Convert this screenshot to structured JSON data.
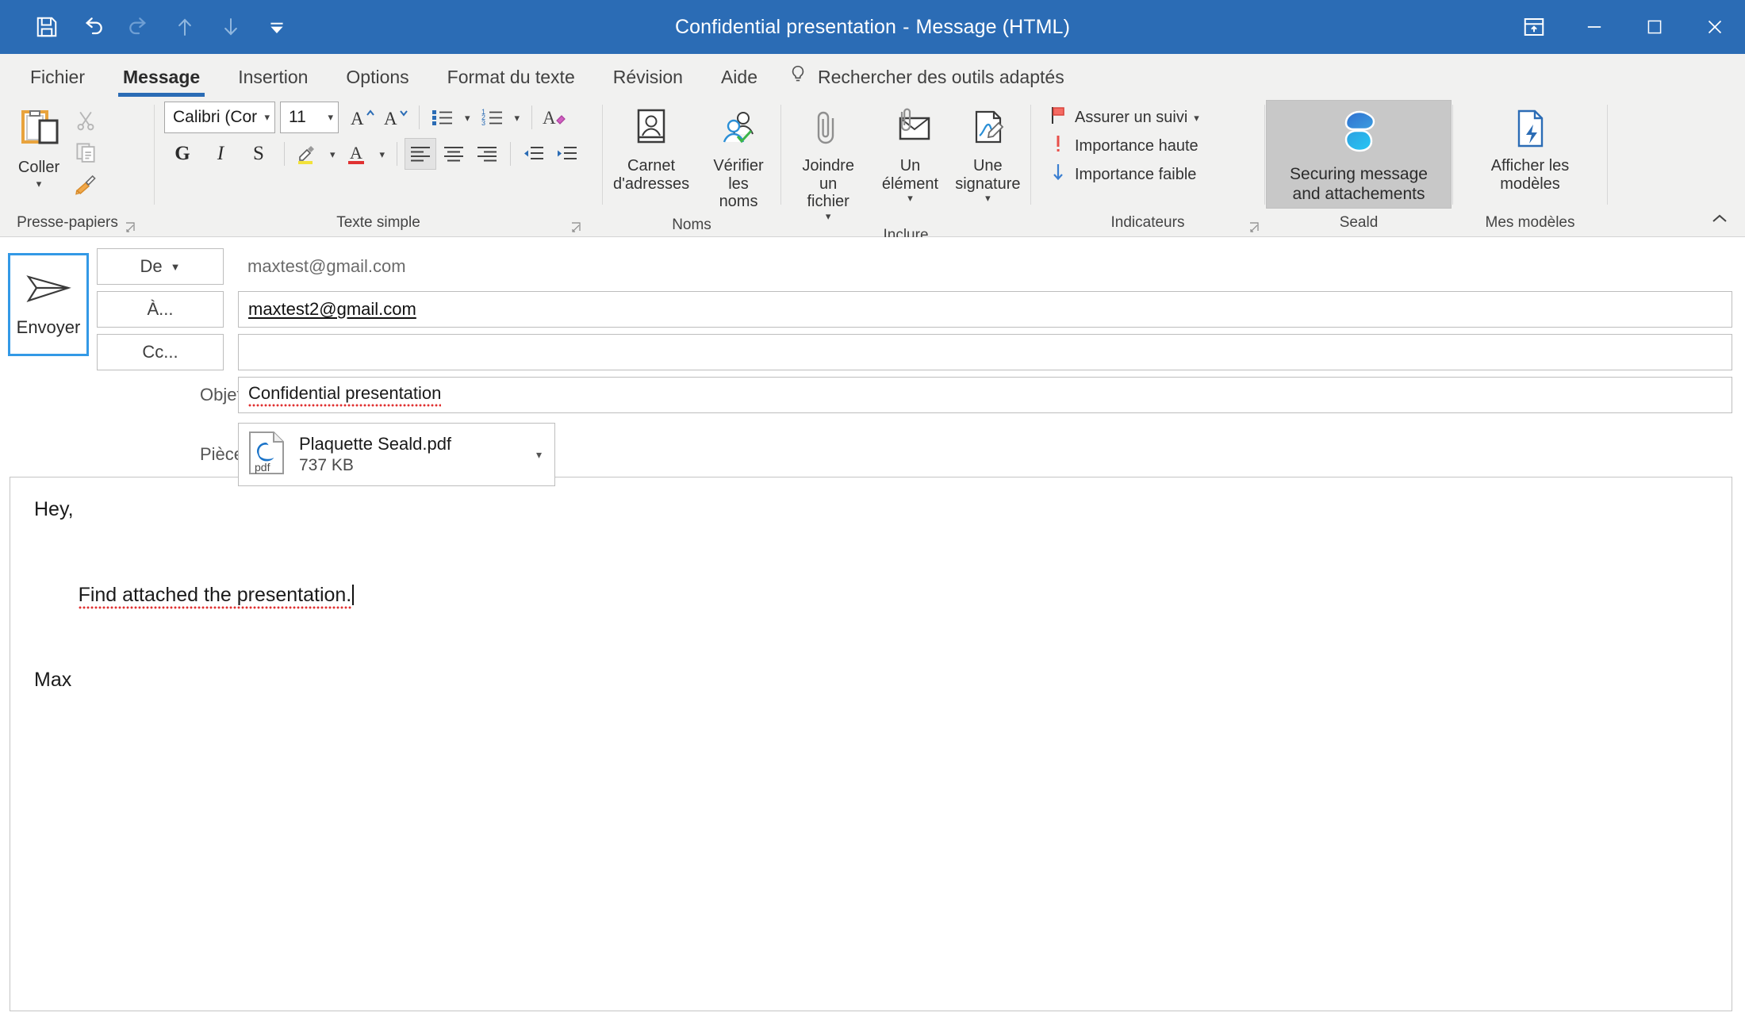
{
  "window": {
    "title": "Confidential presentation",
    "title_separator": "-",
    "title_suffix": "Message (HTML)",
    "accent_color": "#2b6cb5",
    "quick_access": [
      {
        "name": "save-icon",
        "label": "Enregistrer"
      },
      {
        "name": "undo-icon",
        "label": "Annuler"
      },
      {
        "name": "redo-icon",
        "label": "Rétablir"
      },
      {
        "name": "previous-item-icon",
        "label": "Élément précédent"
      },
      {
        "name": "next-item-icon",
        "label": "Élément suivant"
      },
      {
        "name": "customize-quick-access-icon",
        "label": "Personnaliser la barre d'outils Accès rapide"
      }
    ],
    "controls": {
      "ribbon_display": "Options d'affichage du ruban",
      "minimize": "Réduire",
      "maximize": "Agrandir",
      "close": "Fermer"
    }
  },
  "tabs": [
    {
      "label": "Fichier",
      "active": false
    },
    {
      "label": "Message",
      "active": true
    },
    {
      "label": "Insertion",
      "active": false
    },
    {
      "label": "Options",
      "active": false
    },
    {
      "label": "Format du texte",
      "active": false
    },
    {
      "label": "Révision",
      "active": false
    },
    {
      "label": "Aide",
      "active": false
    }
  ],
  "tell_me": {
    "icon": "lightbulb-icon",
    "text": "Rechercher des outils adaptés"
  },
  "ribbon": {
    "collapse_label": "Réduire le ruban",
    "groups": [
      {
        "name": "clipboard",
        "label": "Presse-papiers",
        "has_launcher": true,
        "paste": {
          "label": "Coller",
          "has_dropdown": true
        },
        "items": [
          {
            "name": "cut-icon",
            "label": "Couper",
            "disabled": true
          },
          {
            "name": "copy-icon",
            "label": "Copier",
            "disabled": true
          },
          {
            "name": "format-painter-icon",
            "label": "Reproduire la mise en forme"
          }
        ]
      },
      {
        "name": "basic-text",
        "label": "Texte simple",
        "has_launcher": true,
        "font_name": "Calibri (Cor",
        "font_size": "11",
        "buttons": [
          {
            "name": "grow-font-button",
            "label": "A"
          },
          {
            "name": "shrink-font-button",
            "label": "A"
          },
          {
            "name": "bullets-button",
            "label": "Puces"
          },
          {
            "name": "numbering-button",
            "label": "Numérotation"
          },
          {
            "name": "clear-formatting-button",
            "label": "Effacer la mise en forme"
          },
          {
            "name": "bold-button",
            "label": "G"
          },
          {
            "name": "italic-button",
            "label": "I"
          },
          {
            "name": "underline-button",
            "label": "S"
          },
          {
            "name": "text-highlight-button",
            "label": "Couleur de surlignage du texte"
          },
          {
            "name": "font-color-button",
            "label": "Couleur de police"
          },
          {
            "name": "align-left-button",
            "label": "Aligner à gauche"
          },
          {
            "name": "align-center-button",
            "label": "Centrer"
          },
          {
            "name": "align-right-button",
            "label": "Aligner à droite"
          },
          {
            "name": "decrease-indent-button",
            "label": "Diminuer le retrait"
          },
          {
            "name": "increase-indent-button",
            "label": "Augmenter le retrait"
          }
        ]
      },
      {
        "name": "names",
        "label": "Noms",
        "has_launcher": false,
        "items": [
          {
            "name": "address-book-button",
            "label": "Carnet\nd'adresses"
          },
          {
            "name": "check-names-button",
            "label": "Vérifier\nles noms"
          }
        ]
      },
      {
        "name": "include",
        "label": "Inclure",
        "has_launcher": false,
        "items": [
          {
            "name": "attach-file-button",
            "label": "Joindre un\nfichier",
            "has_dropdown": true
          },
          {
            "name": "attach-item-button",
            "label": "Un\nélément",
            "has_dropdown": true
          },
          {
            "name": "signature-button",
            "label": "Une\nsignature",
            "has_dropdown": true
          }
        ]
      },
      {
        "name": "tags",
        "label": "Indicateurs",
        "has_launcher": true,
        "items": [
          {
            "name": "follow-up-button",
            "label": "Assurer un suivi",
            "has_dropdown": true,
            "color": "#e8504a"
          },
          {
            "name": "high-importance-button",
            "label": "Importance haute",
            "color": "#e8504a"
          },
          {
            "name": "low-importance-button",
            "label": "Importance faible",
            "color": "#3b7fd1"
          }
        ]
      },
      {
        "name": "seald",
        "label": "Seald",
        "has_launcher": false,
        "button": {
          "name": "securing-message-button",
          "label": "Securing message\nand attachements",
          "has_dropdown": true,
          "active": true,
          "logo_colors": [
            "#2f6fd0",
            "#2e9fe0",
            "#25c8f5"
          ]
        }
      },
      {
        "name": "my-templates",
        "label": "Mes modèles",
        "has_launcher": false,
        "button": {
          "name": "view-templates-button",
          "label": "Afficher les\nmodèles"
        }
      }
    ]
  },
  "compose": {
    "send_button": {
      "label": "Envoyer",
      "icon": "send-paper-plane-icon",
      "focused": true
    },
    "from": {
      "button_label": "De",
      "has_dropdown": true,
      "value": "maxtest@gmail.com"
    },
    "to": {
      "button_label": "À...",
      "value": "maxtest2@gmail.com"
    },
    "cc": {
      "button_label": "Cc...",
      "value": ""
    },
    "subject": {
      "label": "Objet",
      "value": "Confidential presentation"
    },
    "attachments": {
      "label": "Pièces jointes",
      "items": [
        {
          "name": "Plaquette Seald.pdf",
          "size": "737 KB",
          "icon": "pdf-file-icon",
          "has_dropdown": true
        }
      ]
    }
  },
  "body": {
    "lines": [
      "Hey,",
      "Find attached the presentation.",
      "Max"
    ],
    "cursor_line_index": 1
  }
}
